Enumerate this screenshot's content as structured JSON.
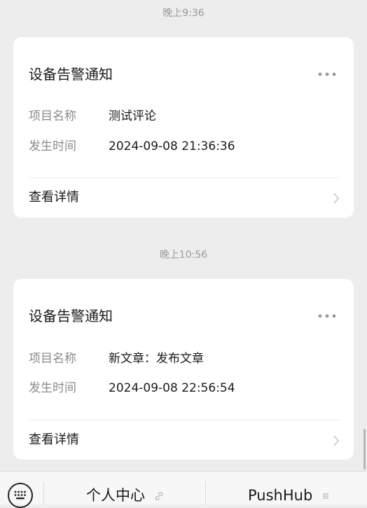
{
  "messages": [
    {
      "time": "晚上9:36",
      "title": "设备告警通知",
      "fields": [
        {
          "label": "项目名称",
          "value": "测试评论"
        },
        {
          "label": "发生时间",
          "value": "2024-09-08 21:36:36"
        }
      ],
      "action_label": "查看详情"
    },
    {
      "time": "晚上10:56",
      "title": "设备告警通知",
      "fields": [
        {
          "label": "项目名称",
          "value": "新文章：发布文章"
        },
        {
          "label": "发生时间",
          "value": "2024-09-08 22:56:54"
        }
      ],
      "action_label": "查看详情"
    }
  ],
  "bottom_menu": {
    "keyboard_icon": "keyboard-icon",
    "items": [
      {
        "label": "个人中心",
        "icon": "link-icon"
      },
      {
        "label": "PushHub",
        "icon": "menu-lines-icon"
      }
    ]
  },
  "colors": {
    "background": "#ededed",
    "card": "#ffffff",
    "muted_text": "#8a8a8a",
    "time_text": "#9a9a9a"
  }
}
